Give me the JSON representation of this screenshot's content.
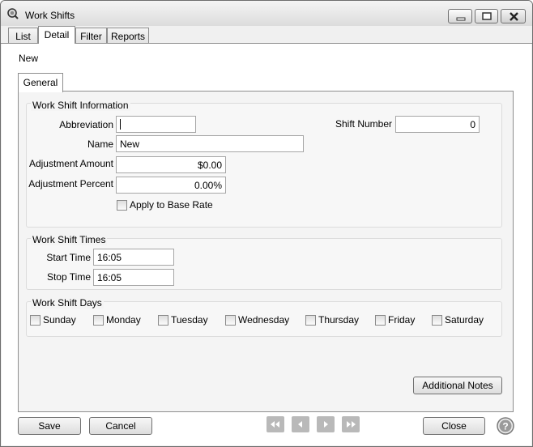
{
  "window": {
    "title": "Work Shifts",
    "controls": {
      "minimize": "minimize",
      "maximize": "maximize",
      "close": "close"
    }
  },
  "tabs": [
    {
      "label": "List",
      "active": false
    },
    {
      "label": "Detail",
      "active": true
    },
    {
      "label": "Filter",
      "active": false
    },
    {
      "label": "Reports",
      "active": false
    }
  ],
  "record_status": "New",
  "subtabs": [
    {
      "label": "General",
      "active": true
    }
  ],
  "work_shift_information": {
    "title": "Work Shift Information",
    "abbreviation": {
      "label": "Abbreviation",
      "value": ""
    },
    "shift_number": {
      "label": "Shift Number",
      "value": "0"
    },
    "name": {
      "label": "Name",
      "value": "New"
    },
    "adjustment_amount": {
      "label": "Adjustment Amount",
      "value": "$0.00"
    },
    "adjustment_percent": {
      "label": "Adjustment Percent",
      "value": "0.00%"
    },
    "apply_to_base_rate": {
      "label": "Apply to Base Rate",
      "checked": false
    }
  },
  "work_shift_times": {
    "title": "Work Shift Times",
    "start_time": {
      "label": "Start Time",
      "value": "16:05"
    },
    "stop_time": {
      "label": "Stop Time",
      "value": "16:05"
    }
  },
  "work_shift_days": {
    "title": "Work Shift Days",
    "days": [
      {
        "label": "Sunday",
        "checked": false
      },
      {
        "label": "Monday",
        "checked": false
      },
      {
        "label": "Tuesday",
        "checked": false
      },
      {
        "label": "Wednesday",
        "checked": false
      },
      {
        "label": "Thursday",
        "checked": false
      },
      {
        "label": "Friday",
        "checked": false
      },
      {
        "label": "Saturday",
        "checked": false
      }
    ]
  },
  "buttons": {
    "additional_notes": "Additional Notes",
    "save": "Save",
    "cancel": "Cancel",
    "close": "Close"
  },
  "icons": {
    "app": "magnifier-icon",
    "nav": [
      "first-record-icon",
      "previous-record-icon",
      "next-record-icon",
      "last-record-icon"
    ],
    "help": "help-icon"
  }
}
